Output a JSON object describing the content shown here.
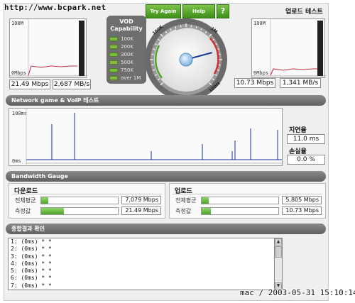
{
  "watermark": "http://www.bcpark.net",
  "timestamp": "mac / 2003-05-31 15:10:14",
  "download": {
    "graph_top_label": "100M",
    "graph_bottom_label": "0Mbps",
    "mbps": "21.49 Mbps",
    "mbs": "2,687 MB/s"
  },
  "upload": {
    "title": "업로드 테스트",
    "graph_top_label": "100M",
    "graph_bottom_label": "0Mbps",
    "mbps": "10.73 Mbps",
    "mbs": "1,341 MB/s"
  },
  "vod": {
    "title": "VOD Capability",
    "levels": [
      "100K",
      "200K",
      "300K",
      "500K",
      "750K",
      "over 1M"
    ]
  },
  "gauge": {
    "try_again": "Try Again",
    "help": "Help",
    "question": "?",
    "scale_labels": [
      "100K",
      "1M",
      "100M"
    ],
    "needle_value_mbps": 21.49,
    "accent": "#4fa52a"
  },
  "network": {
    "title": "Network game & VoIP 테스트",
    "graph_top_label": "100ms",
    "graph_bottom_label": "0ms",
    "latency_label": "지연율",
    "latency_value": "11.0 ms",
    "loss_label": "손실율",
    "loss_value": "0.0 %"
  },
  "bandwidth": {
    "header": "Bandwidth Gauge",
    "down": {
      "title": "다운로드",
      "avg_label": "전체평균",
      "avg_value": "7,079 Mbps",
      "avg_fill": 0.09,
      "meas_label": "측정값",
      "meas_value": "21.49 Mbps",
      "meas_fill": 0.3
    },
    "up": {
      "title": "업로드",
      "avg_label": "전체평균",
      "avg_value": "5,805 Mbps",
      "avg_fill": 0.09,
      "meas_label": "측정값",
      "meas_value": "10.73 Mbps",
      "meas_fill": 0.12
    }
  },
  "results": {
    "header": "종합결과 확인",
    "lines": [
      "1: (0ms) * *",
      "2: (0ms) * *",
      "3: (0ms) * *",
      "4: (0ms) * *",
      "5: (0ms) * *",
      "6: (0ms) * *",
      "7: (0ms) * *"
    ]
  }
}
